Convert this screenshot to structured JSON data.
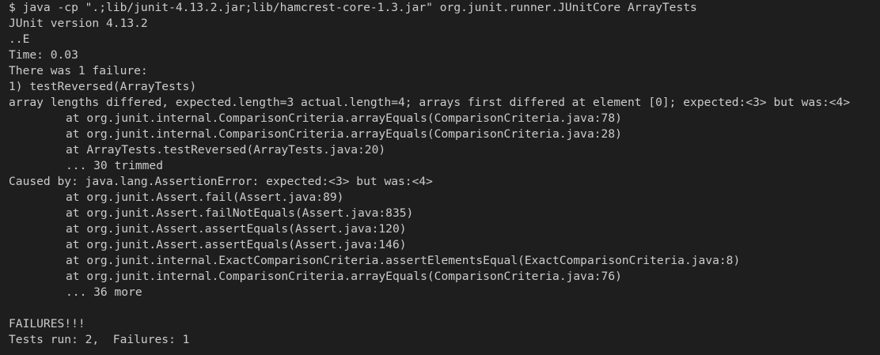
{
  "terminal": {
    "lines": [
      {
        "text": "$ java -cp \".;lib/junit-4.13.2.jar;lib/hamcrest-core-1.3.jar\" org.junit.runner.JUnitCore ArrayTests",
        "indent": false
      },
      {
        "text": "JUnit version 4.13.2",
        "indent": false
      },
      {
        "text": "..E",
        "indent": false
      },
      {
        "text": "Time: 0.03",
        "indent": false
      },
      {
        "text": "There was 1 failure:",
        "indent": false
      },
      {
        "text": "1) testReversed(ArrayTests)",
        "indent": false
      },
      {
        "text": "array lengths differed, expected.length=3 actual.length=4; arrays first differed at element [0]; expected:<3> but was:<4>",
        "indent": false
      },
      {
        "text": "at org.junit.internal.ComparisonCriteria.arrayEquals(ComparisonCriteria.java:78)",
        "indent": true
      },
      {
        "text": "at org.junit.internal.ComparisonCriteria.arrayEquals(ComparisonCriteria.java:28)",
        "indent": true
      },
      {
        "text": "at ArrayTests.testReversed(ArrayTests.java:20)",
        "indent": true
      },
      {
        "text": "... 30 trimmed",
        "indent": true
      },
      {
        "text": "Caused by: java.lang.AssertionError: expected:<3> but was:<4>",
        "indent": false
      },
      {
        "text": "at org.junit.Assert.fail(Assert.java:89)",
        "indent": true
      },
      {
        "text": "at org.junit.Assert.failNotEquals(Assert.java:835)",
        "indent": true
      },
      {
        "text": "at org.junit.Assert.assertEquals(Assert.java:120)",
        "indent": true
      },
      {
        "text": "at org.junit.Assert.assertEquals(Assert.java:146)",
        "indent": true
      },
      {
        "text": "at org.junit.internal.ExactComparisonCriteria.assertElementsEqual(ExactComparisonCriteria.java:8)",
        "indent": true
      },
      {
        "text": "at org.junit.internal.ComparisonCriteria.arrayEquals(ComparisonCriteria.java:76)",
        "indent": true
      },
      {
        "text": "... 36 more",
        "indent": true
      },
      {
        "text": "",
        "indent": false
      },
      {
        "text": "FAILURES!!!",
        "indent": false
      },
      {
        "text": "Tests run: 2,  Failures: 1",
        "indent": false
      }
    ]
  },
  "colors": {
    "background": "#1e1e1e",
    "foreground": "#cccccc"
  }
}
